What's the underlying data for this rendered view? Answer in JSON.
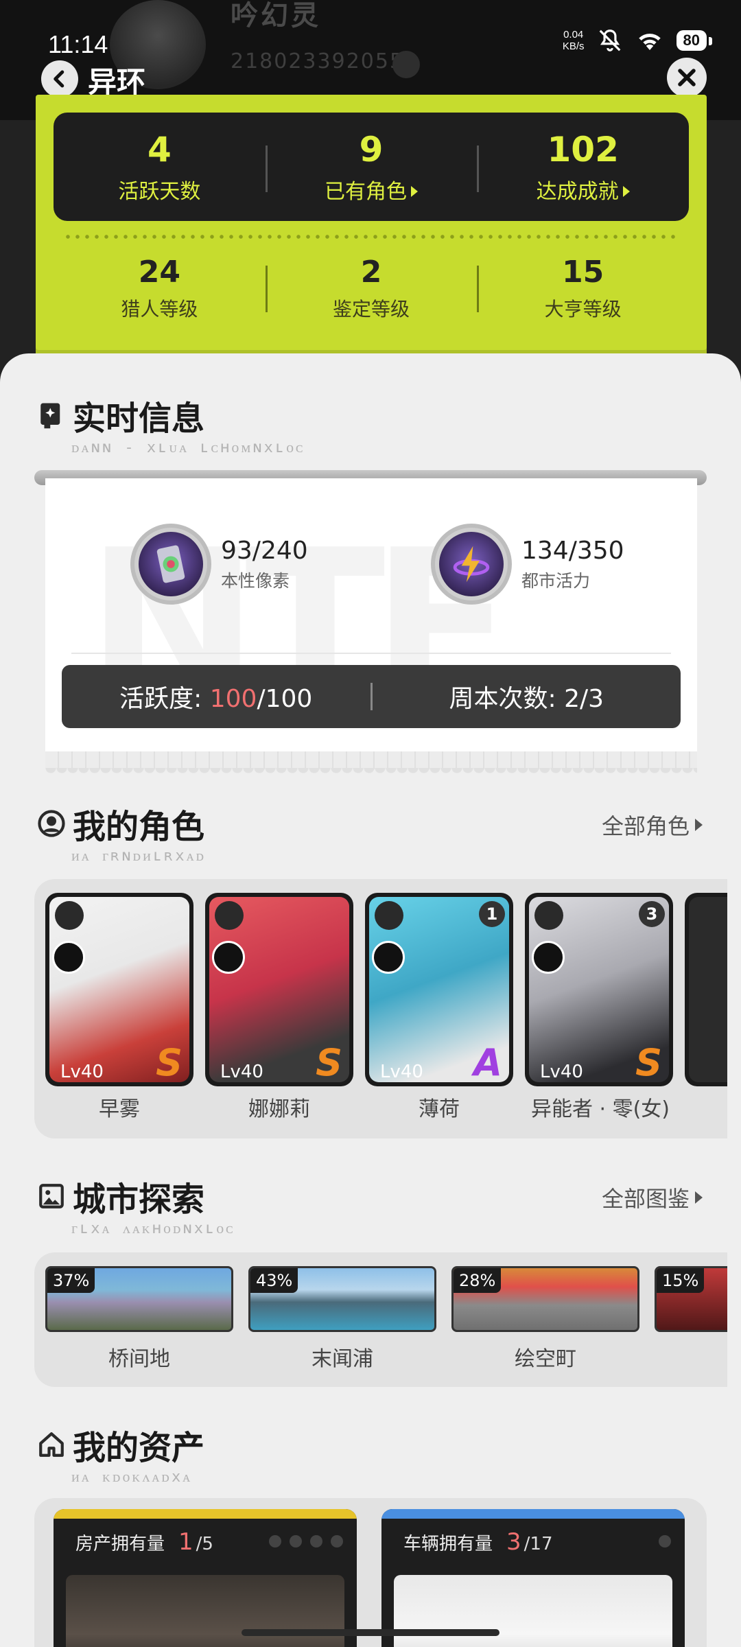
{
  "status": {
    "time": "11:14",
    "net_speed_value": "0.04",
    "net_speed_unit": "KB/s",
    "battery": "80"
  },
  "header": {
    "title": "异环",
    "ghost_name": "吟幻灵",
    "ghost_uid": "218023392055"
  },
  "stats_top": [
    {
      "value": "4",
      "label": "活跃天数",
      "arrow": false
    },
    {
      "value": "9",
      "label": "已有角色",
      "arrow": true
    },
    {
      "value": "102",
      "label": "达成成就",
      "arrow": true
    }
  ],
  "stats_bottom": [
    {
      "value": "24",
      "label": "猎人等级"
    },
    {
      "value": "2",
      "label": "鉴定等级"
    },
    {
      "value": "15",
      "label": "大亨等级"
    }
  ],
  "realtime": {
    "title": "实时信息",
    "subtitle": "ᴅᴀɴɴ - xʟᴜᴀ ʟᴄʜᴏᴍɴxʟᴏᴄ",
    "items": [
      {
        "icon": "pixel-card-icon",
        "value": "93/240",
        "label": "本性像素"
      },
      {
        "icon": "lightning-energy-icon",
        "value": "134/350",
        "label": "都市活力"
      }
    ],
    "activity_label": "活跃度: ",
    "activity_current": "100",
    "activity_total": "/100",
    "weekly_label": "周本次数: ",
    "weekly_value": "2/3"
  },
  "characters": {
    "title": "我的角色",
    "subtitle": "ᴎᴀ ᴦʀɴᴅᴎʟʀxᴀᴅ",
    "see_all": "全部角色",
    "items": [
      {
        "name": "早雾",
        "level": "Lv40",
        "rank": "S",
        "rank_color": "#f08a20",
        "badge": "",
        "art_color": "#c9403a"
      },
      {
        "name": "娜娜莉",
        "level": "Lv40",
        "rank": "S",
        "rank_color": "#f08a20",
        "badge": "",
        "art_color": "#d64a55"
      },
      {
        "name": "薄荷",
        "level": "Lv40",
        "rank": "A",
        "rank_color": "#a040e0",
        "badge": "1",
        "art_color": "#4fb8d0"
      },
      {
        "name": "异能者 · 零(女)",
        "level": "Lv40",
        "rank": "S",
        "rank_color": "#f08a20",
        "badge": "3",
        "art_color": "#8a8a90"
      }
    ]
  },
  "city": {
    "title": "城市探索",
    "subtitle": "ᴦʟxᴀ ᴧᴀᴋʜᴏᴅɴxʟᴏᴄ",
    "see_all": "全部图鉴",
    "items": [
      {
        "name": "桥间地",
        "percent": "37%"
      },
      {
        "name": "末闻浦",
        "percent": "43%"
      },
      {
        "name": "绘空町",
        "percent": "28%"
      },
      {
        "name": "",
        "percent": "15%"
      }
    ]
  },
  "assets": {
    "title": "我的资产",
    "subtitle": "ᴎᴀ ᴋᴅᴏᴋᴧᴀᴅxᴀ",
    "items": [
      {
        "label": "房产拥有量",
        "current": "1",
        "total": "/5",
        "stripe": "#e6c32a"
      },
      {
        "label": "车辆拥有量",
        "current": "3",
        "total": "/17",
        "stripe": "#4a8fe0"
      }
    ]
  }
}
